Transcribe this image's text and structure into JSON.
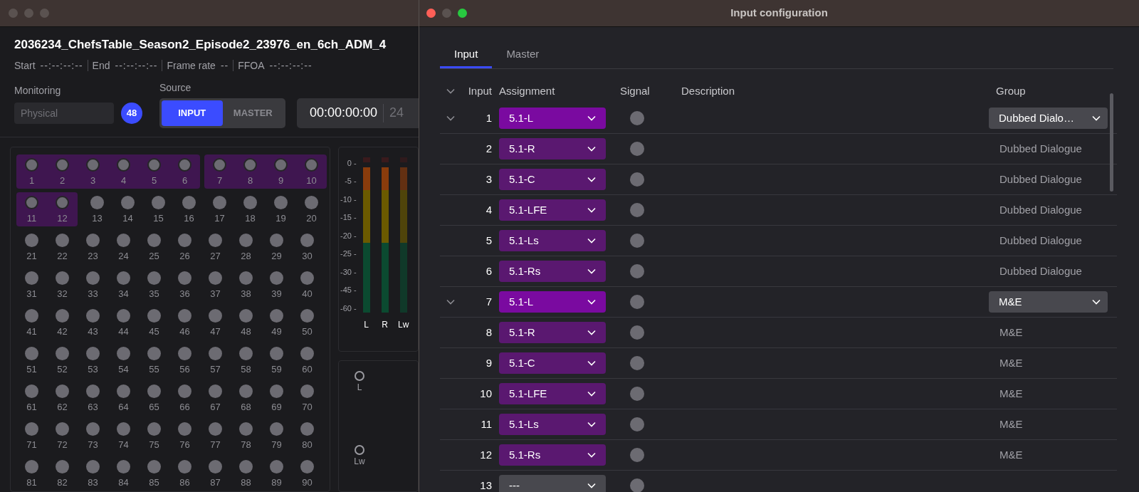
{
  "main_window": {
    "file_name": "2036234_ChefsTable_Season2_Episode2_23976_en_6ch_ADM_4",
    "metadata": [
      {
        "label": "Start",
        "value": "--:--:--:--"
      },
      {
        "label": "End",
        "value": "--:--:--:--"
      },
      {
        "label": "Frame rate",
        "value": "--"
      },
      {
        "label": "FFOA",
        "value": "--:--:--:--"
      }
    ],
    "monitoring": {
      "label": "Monitoring",
      "placeholder": "Physical",
      "badge": "48"
    },
    "source": {
      "label": "Source",
      "options": [
        {
          "label": "INPUT",
          "selected": true
        },
        {
          "label": "MASTER",
          "selected": false
        }
      ]
    },
    "timecode": {
      "value": "00:00:00:00",
      "rate": "24"
    },
    "pad_grid": {
      "rows": [
        {
          "segments": [
            {
              "highlighted": true,
              "pads": [
                "1",
                "2",
                "3",
                "4",
                "5",
                "6"
              ]
            },
            {
              "highlighted": true,
              "pads": [
                "7",
                "8",
                "9",
                "10"
              ]
            }
          ]
        },
        {
          "segments": [
            {
              "highlighted": true,
              "pads": [
                "11",
                "12"
              ]
            },
            {
              "highlighted": false,
              "pads": [
                "13",
                "14",
                "15",
                "16",
                "17",
                "18",
                "19",
                "20"
              ]
            }
          ]
        },
        {
          "segments": [
            {
              "highlighted": false,
              "pads": [
                "21",
                "22",
                "23",
                "24",
                "25",
                "26",
                "27",
                "28",
                "29",
                "30"
              ]
            }
          ]
        },
        {
          "segments": [
            {
              "highlighted": false,
              "pads": [
                "31",
                "32",
                "33",
                "34",
                "35",
                "36",
                "37",
                "38",
                "39",
                "40"
              ]
            }
          ]
        },
        {
          "segments": [
            {
              "highlighted": false,
              "pads": [
                "41",
                "42",
                "43",
                "44",
                "45",
                "46",
                "47",
                "48",
                "49",
                "50"
              ]
            }
          ]
        },
        {
          "segments": [
            {
              "highlighted": false,
              "pads": [
                "51",
                "52",
                "53",
                "54",
                "55",
                "56",
                "57",
                "58",
                "59",
                "60"
              ]
            }
          ]
        },
        {
          "segments": [
            {
              "highlighted": false,
              "pads": [
                "61",
                "62",
                "63",
                "64",
                "65",
                "66",
                "67",
                "68",
                "69",
                "70"
              ]
            }
          ]
        },
        {
          "segments": [
            {
              "highlighted": false,
              "pads": [
                "71",
                "72",
                "73",
                "74",
                "75",
                "76",
                "77",
                "78",
                "79",
                "80"
              ]
            }
          ]
        },
        {
          "segments": [
            {
              "highlighted": false,
              "pads": [
                "81",
                "82",
                "83",
                "84",
                "85",
                "86",
                "87",
                "88",
                "89",
                "90"
              ]
            }
          ]
        }
      ]
    },
    "meters": {
      "scale": [
        "0 -",
        "-5 -",
        "-10 -",
        "-15 -",
        "-20 -",
        "-25 -",
        "-30 -",
        "-45 -",
        "-60 -"
      ],
      "channels": [
        {
          "label": "L",
          "active": true
        },
        {
          "label": "R",
          "active": true
        },
        {
          "label": "Lw",
          "active": false
        }
      ]
    },
    "speakers": [
      {
        "label": "L"
      },
      {
        "label": "Lw"
      }
    ]
  },
  "dialog": {
    "title": "Input configuration",
    "tabs": [
      {
        "label": "Input",
        "selected": true
      },
      {
        "label": "Master",
        "selected": false
      }
    ],
    "columns": [
      "Input",
      "Assignment",
      "Signal",
      "Description",
      "Group"
    ],
    "rows": [
      {
        "input": "1",
        "assignment": "5.1-L",
        "kind": "head",
        "group": "Dubbed Dialo…"
      },
      {
        "input": "2",
        "assignment": "5.1-R",
        "kind": "member",
        "group": "Dubbed Dialogue"
      },
      {
        "input": "3",
        "assignment": "5.1-C",
        "kind": "member",
        "group": "Dubbed Dialogue"
      },
      {
        "input": "4",
        "assignment": "5.1-LFE",
        "kind": "member",
        "group": "Dubbed Dialogue"
      },
      {
        "input": "5",
        "assignment": "5.1-Ls",
        "kind": "member",
        "group": "Dubbed Dialogue"
      },
      {
        "input": "6",
        "assignment": "5.1-Rs",
        "kind": "member",
        "group": "Dubbed Dialogue"
      },
      {
        "input": "7",
        "assignment": "5.1-L",
        "kind": "head",
        "group": "M&E"
      },
      {
        "input": "8",
        "assignment": "5.1-R",
        "kind": "member",
        "group": "M&E"
      },
      {
        "input": "9",
        "assignment": "5.1-C",
        "kind": "member",
        "group": "M&E"
      },
      {
        "input": "10",
        "assignment": "5.1-LFE",
        "kind": "member",
        "group": "M&E"
      },
      {
        "input": "11",
        "assignment": "5.1-Ls",
        "kind": "member",
        "group": "M&E"
      },
      {
        "input": "12",
        "assignment": "5.1-Rs",
        "kind": "member",
        "group": "M&E"
      },
      {
        "input": "13",
        "assignment": "---",
        "kind": "unassigned"
      }
    ]
  }
}
